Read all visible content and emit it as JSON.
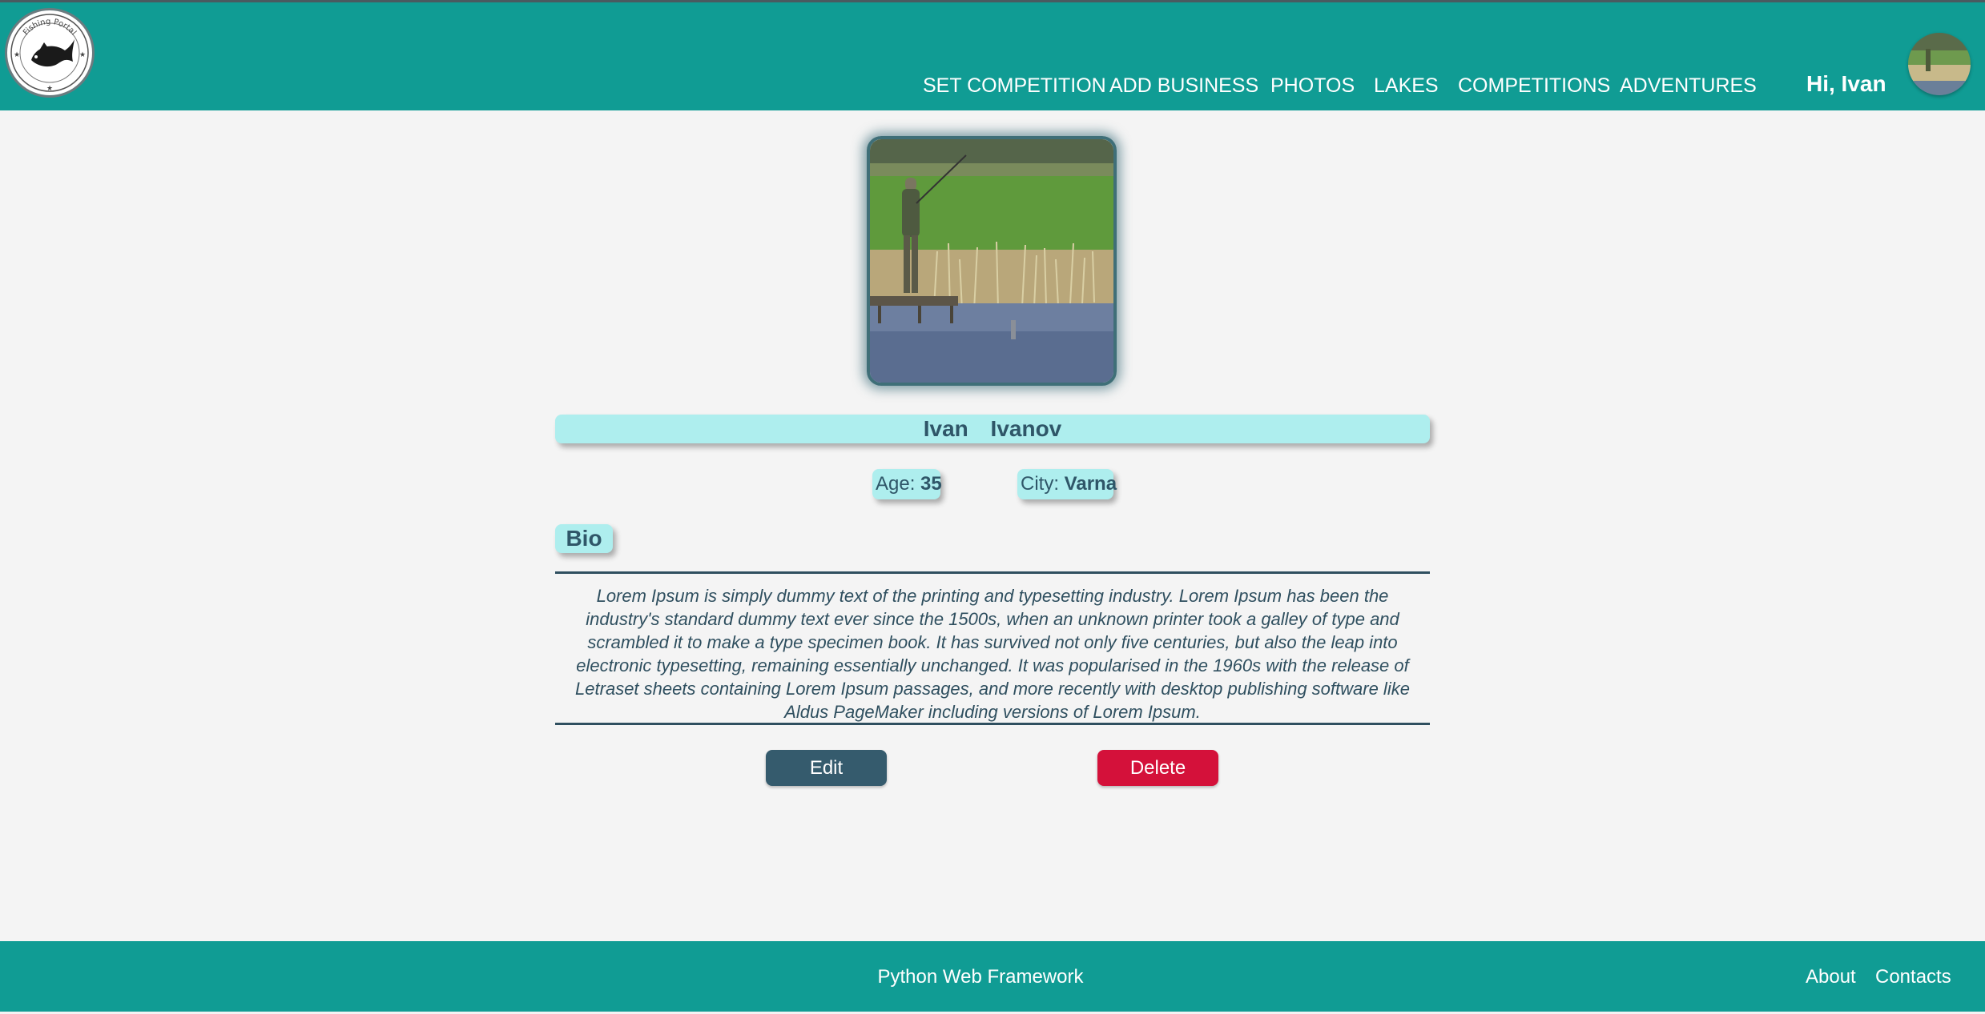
{
  "header": {
    "logo_text": "Fishing Portal",
    "nav": [
      {
        "label": "SET COMPETITION"
      },
      {
        "label": "ADD BUSINESS"
      },
      {
        "label": "PHOTOS"
      },
      {
        "label": "LAKES"
      },
      {
        "label": "COMPETITIONS"
      },
      {
        "label": "ADVENTURES"
      }
    ],
    "greeting": "Hi, Ivan"
  },
  "profile": {
    "first_name": "Ivan",
    "last_name": "Ivanov",
    "age_label": "Age:",
    "age": "35",
    "city_label": "City:",
    "city": "Varna",
    "bio_label": "Bio",
    "bio": "Lorem Ipsum is simply dummy text of the printing and typesetting industry. Lorem Ipsum has been the industry's standard dummy text ever since the 1500s, when an unknown printer took a galley of type and scrambled it to make a type specimen book. It has survived not only five centuries, but also the leap into electronic typesetting, remaining essentially unchanged. It was popularised in the 1960s with the release of Letraset sheets containing Lorem Ipsum passages, and more recently with desktop publishing software like Aldus PageMaker including versions of Lorem Ipsum."
  },
  "actions": {
    "edit_label": "Edit",
    "delete_label": "Delete"
  },
  "footer": {
    "center_text": "Python Web Framework",
    "links": [
      {
        "label": "About"
      },
      {
        "label": "Contacts"
      }
    ]
  },
  "colors": {
    "header_bg": "#109c94",
    "chip_bg": "#aeeeee",
    "edit_button": "#355b6d",
    "delete_button": "#d4113a",
    "text": "#2f4f5f"
  },
  "icons": {
    "logo": "bass-fish-emblem",
    "avatar": "user-photo"
  }
}
